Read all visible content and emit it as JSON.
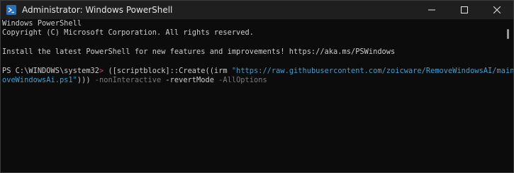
{
  "window": {
    "title": "Administrator: Windows PowerShell"
  },
  "icons": {
    "app": "powershell-icon",
    "minimize": "minimize-icon",
    "maximize": "maximize-icon",
    "close": "close-icon"
  },
  "colors": {
    "background": "#0c0c0c",
    "text": "#cccccc",
    "prompt_marker": "#c64b60",
    "string": "#3aa0d6",
    "dim": "#7a7a7a"
  },
  "console": {
    "banner_line1": "Windows PowerShell",
    "banner_line2": "Copyright (C) Microsoft Corporation. All rights reserved.",
    "install_message": "Install the latest PowerShell for new features and improvements! https://aka.ms/PSWindows",
    "prompt": "PS C:\\WINDOWS\\system32",
    "prompt_marker": ">",
    "command_prefix": " ([scriptblock]::Create((irm ",
    "url_part1": "\"https://raw.githubusercontent.com/zoicware/RemoveWindowsAI/main/Rem",
    "url_part2": "oveWindowsAi.ps1\"",
    "command_close": ")))",
    "param1": " -nonInteractive",
    "param2": " -revertMode",
    "param3": " -AllOptions"
  }
}
